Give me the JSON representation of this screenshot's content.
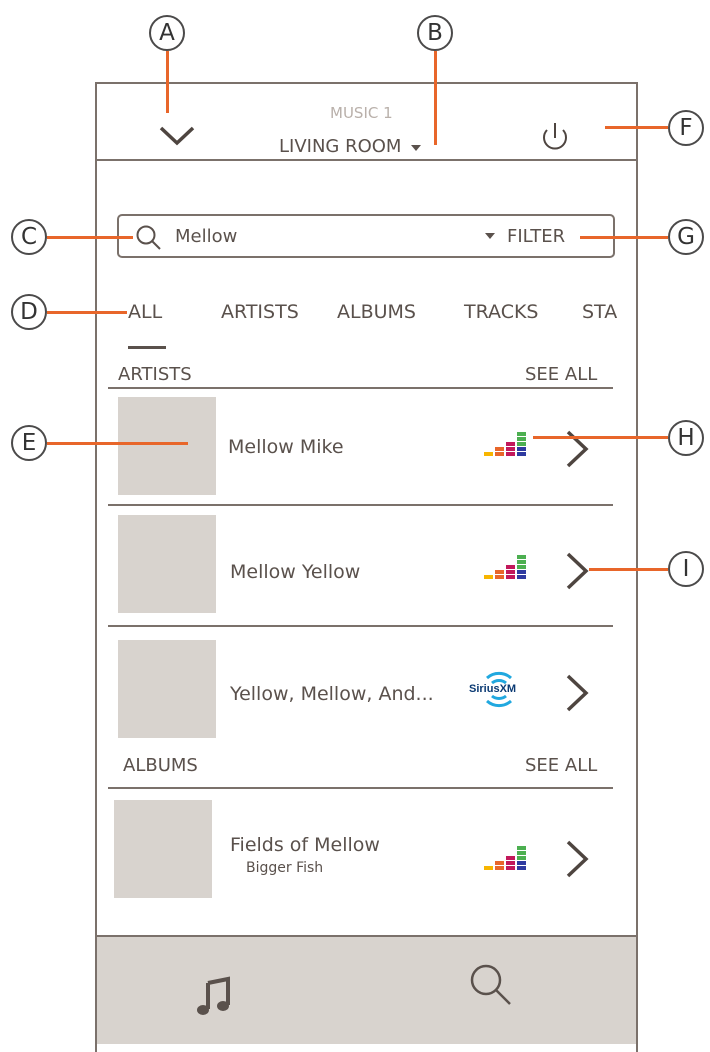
{
  "header": {
    "source_label": "MUSIC 1",
    "room_label": "LIVING ROOM",
    "room_caret": "▾"
  },
  "search": {
    "query": "Mellow",
    "filter_label": "FILTER",
    "filter_caret": "▾"
  },
  "tabs": [
    {
      "label": "ALL",
      "selected": true
    },
    {
      "label": "ARTISTS",
      "selected": false
    },
    {
      "label": "ALBUMS",
      "selected": false
    },
    {
      "label": "TRACKS",
      "selected": false
    },
    {
      "label": "STA",
      "selected": false
    }
  ],
  "sections": {
    "artists": {
      "title": "ARTISTS",
      "see_all": "SEE ALL"
    },
    "albums": {
      "title": "ALBUMS",
      "see_all": "SEE ALL"
    }
  },
  "artist_rows": [
    {
      "title": "Mellow Mike",
      "service": "deezer-icon"
    },
    {
      "title": "Mellow Yellow",
      "service": "deezer-icon"
    },
    {
      "title": "Yellow, Mellow, And...",
      "service": "siriusxm-icon",
      "service_label": "SiriusXM"
    }
  ],
  "album_rows": [
    {
      "title": "Fields of Mellow",
      "subtitle": "Bigger Fish",
      "service": "deezer-icon"
    }
  ],
  "bottom_tabs": [
    {
      "name": "music-note-icon"
    },
    {
      "name": "search-icon"
    }
  ],
  "callouts": [
    "A",
    "B",
    "C",
    "D",
    "E",
    "F",
    "G",
    "H",
    "I"
  ],
  "colors": {
    "accent_line": "#e8662a",
    "frame": "#7b716b",
    "placeholder": "#d8d3ce",
    "text": "#5a514c"
  }
}
